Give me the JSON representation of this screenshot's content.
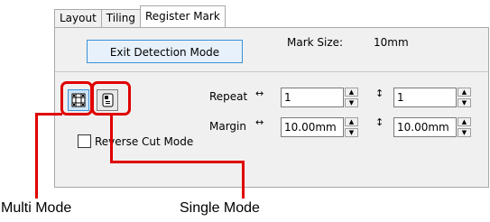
{
  "tabs": [
    {
      "label": "Layout"
    },
    {
      "label": "Tiling"
    },
    {
      "label": "Register Mark"
    }
  ],
  "active_tab": "Register Mark",
  "exit_button": {
    "label": "Exit Detection Mode"
  },
  "mark_size": {
    "label": "Mark Size:",
    "value": "10mm"
  },
  "mode_buttons": {
    "multi_icon": "multi-mark-icon",
    "single_icon": "single-mark-icon"
  },
  "reverse_cut": {
    "label": "Reverse Cut Mode",
    "checked": false
  },
  "repeat": {
    "label": "Repeat",
    "horizontal_symbol": "↔",
    "vertical_symbol": "↕",
    "horizontal_value": "1",
    "vertical_value": "1"
  },
  "margin": {
    "label": "Margin",
    "horizontal_symbol": "↔",
    "vertical_symbol": "↕",
    "horizontal_value": "10.00mm",
    "vertical_value": "10.00mm"
  },
  "annotations": {
    "multi": "Multi Mode",
    "single": "Single Mode"
  },
  "colors": {
    "callout": "#e00000",
    "selected_button": "#cce4f7",
    "panel_bg": "#f0f0f0"
  }
}
